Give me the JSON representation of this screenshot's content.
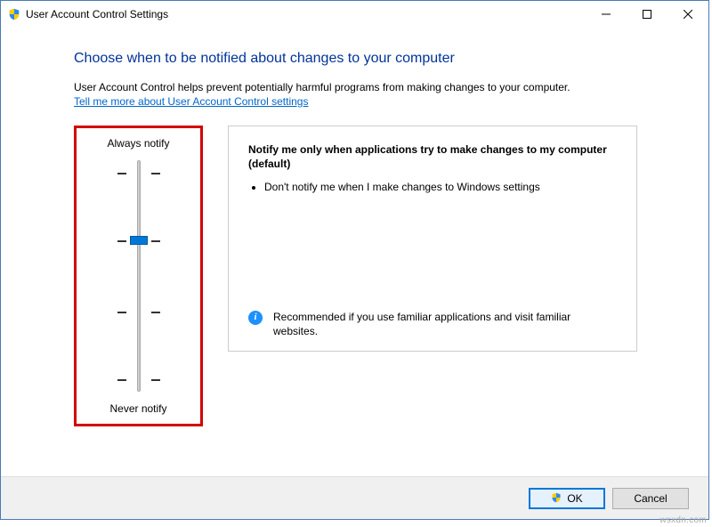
{
  "window": {
    "title": "User Account Control Settings"
  },
  "heading": "Choose when to be notified about changes to your computer",
  "subtext": "User Account Control helps prevent potentially harmful programs from making changes to your computer.",
  "link": "Tell me more about User Account Control settings",
  "slider": {
    "top_label": "Always notify",
    "bottom_label": "Never notify",
    "levels": 4,
    "selected_index": 1
  },
  "description": {
    "title": "Notify me only when applications try to make changes to my computer (default)",
    "bullets": [
      "Don't notify me when I make changes to Windows settings"
    ],
    "recommendation": "Recommended if you use familiar applications and visit familiar websites."
  },
  "buttons": {
    "ok": "OK",
    "cancel": "Cancel"
  },
  "watermark": "wsxdn.com"
}
